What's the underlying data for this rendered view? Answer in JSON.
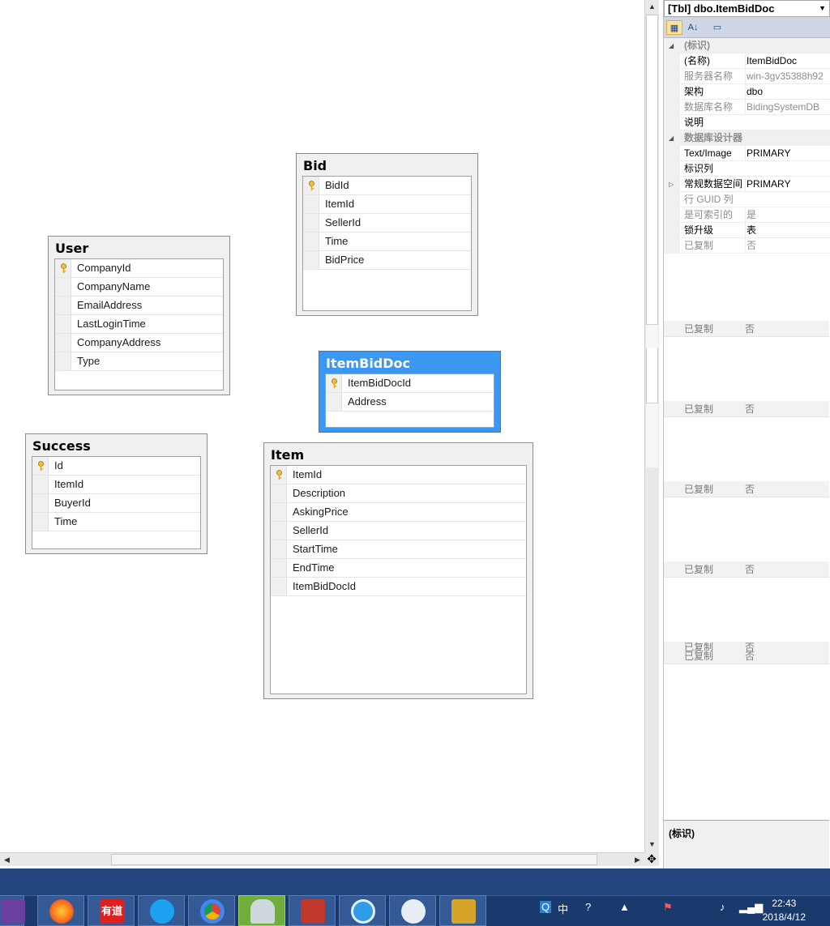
{
  "tables": [
    {
      "id": "bid",
      "title": "Bid",
      "columns": [
        {
          "name": "BidId",
          "pk": true
        },
        {
          "name": "ItemId"
        },
        {
          "name": "SellerId"
        },
        {
          "name": "Time"
        },
        {
          "name": "BidPrice"
        }
      ]
    },
    {
      "id": "user",
      "title": "User",
      "columns": [
        {
          "name": "CompanyId",
          "pk": true
        },
        {
          "name": "CompanyName"
        },
        {
          "name": "EmailAddress"
        },
        {
          "name": "LastLoginTime"
        },
        {
          "name": "CompanyAddress"
        },
        {
          "name": "Type"
        }
      ]
    },
    {
      "id": "itembiddoc",
      "title": "ItemBidDoc",
      "selected": true,
      "columns": [
        {
          "name": "ItemBidDocId",
          "pk": true
        },
        {
          "name": "Address"
        }
      ]
    },
    {
      "id": "success",
      "title": "Success",
      "columns": [
        {
          "name": "Id",
          "pk": true
        },
        {
          "name": "ItemId"
        },
        {
          "name": "BuyerId"
        },
        {
          "name": "Time"
        }
      ]
    },
    {
      "id": "item",
      "title": "Item",
      "columns": [
        {
          "name": "ItemId",
          "pk": true
        },
        {
          "name": "Description"
        },
        {
          "name": "AskingPrice"
        },
        {
          "name": "SellerId"
        },
        {
          "name": "StartTime"
        },
        {
          "name": "EndTime"
        },
        {
          "name": "ItemBidDocId"
        }
      ]
    }
  ],
  "properties": {
    "object_selector": "[Tbl] dbo.ItemBidDoc",
    "rows": [
      {
        "type": "cat",
        "key": "(标识)",
        "expanded": true
      },
      {
        "key": "(名称)",
        "value": "ItemBidDoc"
      },
      {
        "key": "服务器名称",
        "value": "win-3gv35388h92",
        "grey": true
      },
      {
        "key": "架构",
        "value": "dbo"
      },
      {
        "key": "数据库名称",
        "value": "BidingSystemDB",
        "grey": true
      },
      {
        "key": "说明",
        "value": ""
      },
      {
        "type": "cat",
        "key": "数据库设计器",
        "expanded": true
      },
      {
        "key": "Text/Image",
        "value": "PRIMARY"
      },
      {
        "key": "标识列",
        "value": ""
      },
      {
        "key": "常规数据空间",
        "value": "PRIMARY",
        "expandable": true
      },
      {
        "key": "行 GUID 列",
        "value": "",
        "grey": true
      },
      {
        "key": "是可索引的",
        "value": "是",
        "grey": true
      },
      {
        "key": "锁升级",
        "value": "表"
      },
      {
        "key": "已复制",
        "value": "否",
        "grey": true
      }
    ],
    "ghost_rows": [
      {
        "key": "已复制",
        "value": "否"
      },
      {
        "key": "已复制",
        "value": "否"
      },
      {
        "key": "已复制",
        "value": "否"
      },
      {
        "key": "已复制",
        "value": "否"
      },
      {
        "key": "已复制\n已复制",
        "value": "否\n否"
      }
    ],
    "description_title": "(标识)"
  },
  "taskbar": {
    "apps": [
      "visual-studio",
      "firefox",
      "youdao",
      "qq-video",
      "chrome",
      "ssms",
      "toolbox",
      "ie",
      "fish-app",
      "sql-config"
    ],
    "youdao_label": "有道",
    "ime": "中",
    "time": "22:43",
    "date": "2018/4/12"
  },
  "colors": {
    "selected_table": "#3c97f0",
    "taskbar": "#1a3a6e"
  }
}
